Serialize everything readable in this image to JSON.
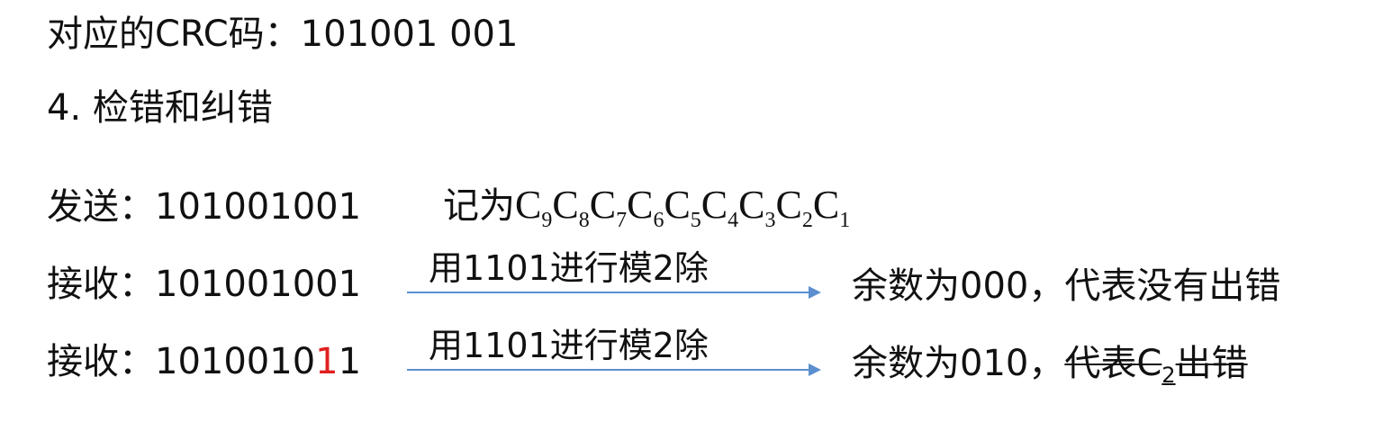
{
  "crc_line": {
    "label": "对应的CRC码：",
    "value": "101001 001"
  },
  "section_heading": "4. 检错和纠错",
  "send_line": {
    "label": "发送：",
    "value": "101001001",
    "notation_prefix": "记为",
    "notation_terms": [
      "C",
      "C",
      "C",
      "C",
      "C",
      "C",
      "C",
      "C",
      "C"
    ],
    "notation_subscripts": [
      "9",
      "8",
      "7",
      "6",
      "5",
      "4",
      "3",
      "2",
      "1"
    ]
  },
  "receive_ok": {
    "label": "接收：",
    "value": "101001001",
    "arrow_label": "用1101进行模2除",
    "result": "余数为000，代表没有出错"
  },
  "receive_err": {
    "label": "接收：",
    "value_before": "1010010",
    "value_flipped_bit": "1",
    "value_after": "1",
    "arrow_label": "用1101进行模2除",
    "result_prefix": "余数为010，",
    "result_struck_a": "代表",
    "result_struck_c": "C",
    "result_struck_sub": "2",
    "result_struck_b": "出错"
  },
  "colors": {
    "text": "#111111",
    "error_bit": "#e02020",
    "arrow": "#5b8fcf"
  }
}
